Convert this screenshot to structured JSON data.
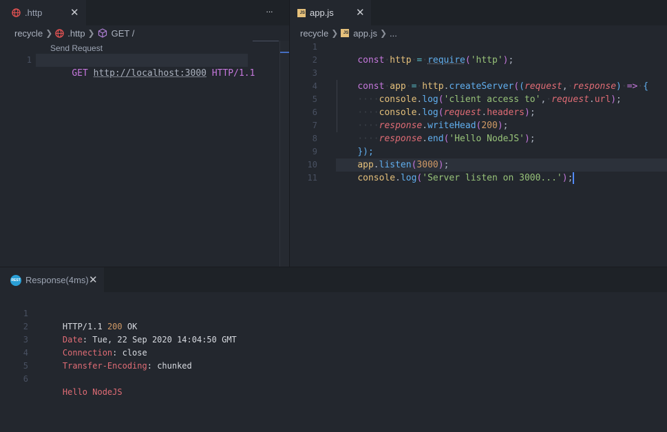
{
  "left_editor": {
    "tab": {
      "label": ".http",
      "close": "✕",
      "more": "···"
    },
    "breadcrumb": {
      "folder": "recycle",
      "file": ".http",
      "symbol": "GET /"
    },
    "codelens": "Send Request",
    "lines": [
      {
        "number": "1",
        "method": "GET",
        "url": "http://localhost:3000",
        "version": "HTTP/1.1"
      }
    ]
  },
  "right_editor": {
    "tab": {
      "label": "app.js",
      "icon_text": "JS",
      "close": "✕"
    },
    "breadcrumb": {
      "folder": "recycle",
      "file": "app.js",
      "rest": "..."
    },
    "line_numbers": [
      "1",
      "2",
      "3",
      "4",
      "5",
      "6",
      "7",
      "8",
      "9",
      "10",
      "11"
    ],
    "code": {
      "l1": {
        "kw": "const",
        "var": "http",
        "eq": "=",
        "fn": "require",
        "arg": "'http'"
      },
      "l3": {
        "kw": "const",
        "var": "app",
        "eq": "=",
        "obj": "http",
        "fn": "createServer",
        "p1": "request",
        "p2": "response",
        "arrow": "=>"
      },
      "l4": {
        "obj": "console",
        "fn": "log",
        "str": "'client access to'",
        "par": "request",
        "prop": "url"
      },
      "l5": {
        "obj": "console",
        "fn": "log",
        "par": "request",
        "prop": "headers"
      },
      "l6": {
        "par": "response",
        "fn": "writeHead",
        "num": "200"
      },
      "l7": {
        "par": "response",
        "fn": "end",
        "str": "'Hello NodeJS'"
      },
      "l8": {
        "text": "});"
      },
      "l9": {
        "obj": "app",
        "fn": "listen",
        "num": "3000"
      },
      "l10": {
        "obj": "console",
        "fn": "log",
        "str": "'Server listen on 3000...'"
      }
    }
  },
  "response_panel": {
    "tab": {
      "label": "Response(4ms)",
      "icon_text": "REST",
      "close": "✕"
    },
    "line_numbers": [
      "1",
      "2",
      "3",
      "4",
      "5",
      "6"
    ],
    "status": {
      "version": "HTTP/1.1",
      "code": "200",
      "text": "OK"
    },
    "headers": [
      {
        "name": "Date",
        "value": "Tue, 22 Sep 2020 14:04:50 GMT"
      },
      {
        "name": "Connection",
        "value": "close"
      },
      {
        "name": "Transfer-Encoding",
        "value": "chunked"
      }
    ],
    "body": "Hello NodeJS"
  },
  "colors": {
    "background": "#23272e",
    "keyword": "#c678dd",
    "function": "#61afef",
    "string": "#98c379",
    "number": "#d19a66",
    "parameter": "#e06c75",
    "variable": "#e5c07b"
  }
}
